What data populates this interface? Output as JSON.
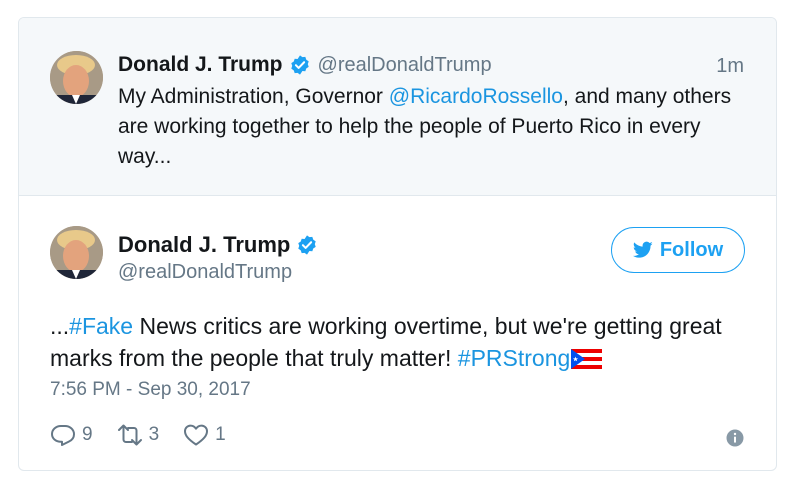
{
  "parent_tweet": {
    "author_name": "Donald J. Trump",
    "author_handle": "@realDonaldTrump",
    "time": "1m",
    "text_before": "My Administration, Governor ",
    "mention": "@RicardoRossello",
    "text_after": ", and many others are working together to help the people of Puerto Rico in every way..."
  },
  "main_tweet": {
    "author_name": "Donald J. Trump",
    "author_handle": "@realDonaldTrump",
    "follow_label": "Follow",
    "text_prefix": "...",
    "hashtag1": "#Fake",
    "text_middle": " News critics are working overtime, but we're getting great marks from the people that truly matter! ",
    "hashtag2": "#PRStrong",
    "timestamp": "7:56 PM - Sep 30, 2017",
    "reply_count": "9",
    "retweet_count": "3",
    "like_count": "1"
  },
  "icons": {
    "verified": "verified-badge-icon",
    "bird": "twitter-bird-icon",
    "reply": "reply-icon",
    "retweet": "retweet-icon",
    "like": "heart-icon",
    "info": "info-icon",
    "flag": "puerto-rico-flag-icon"
  },
  "colors": {
    "link": "#1b95e0",
    "accent": "#1da1f2",
    "muted": "#657786",
    "parent_bg": "#f5f8fa"
  }
}
